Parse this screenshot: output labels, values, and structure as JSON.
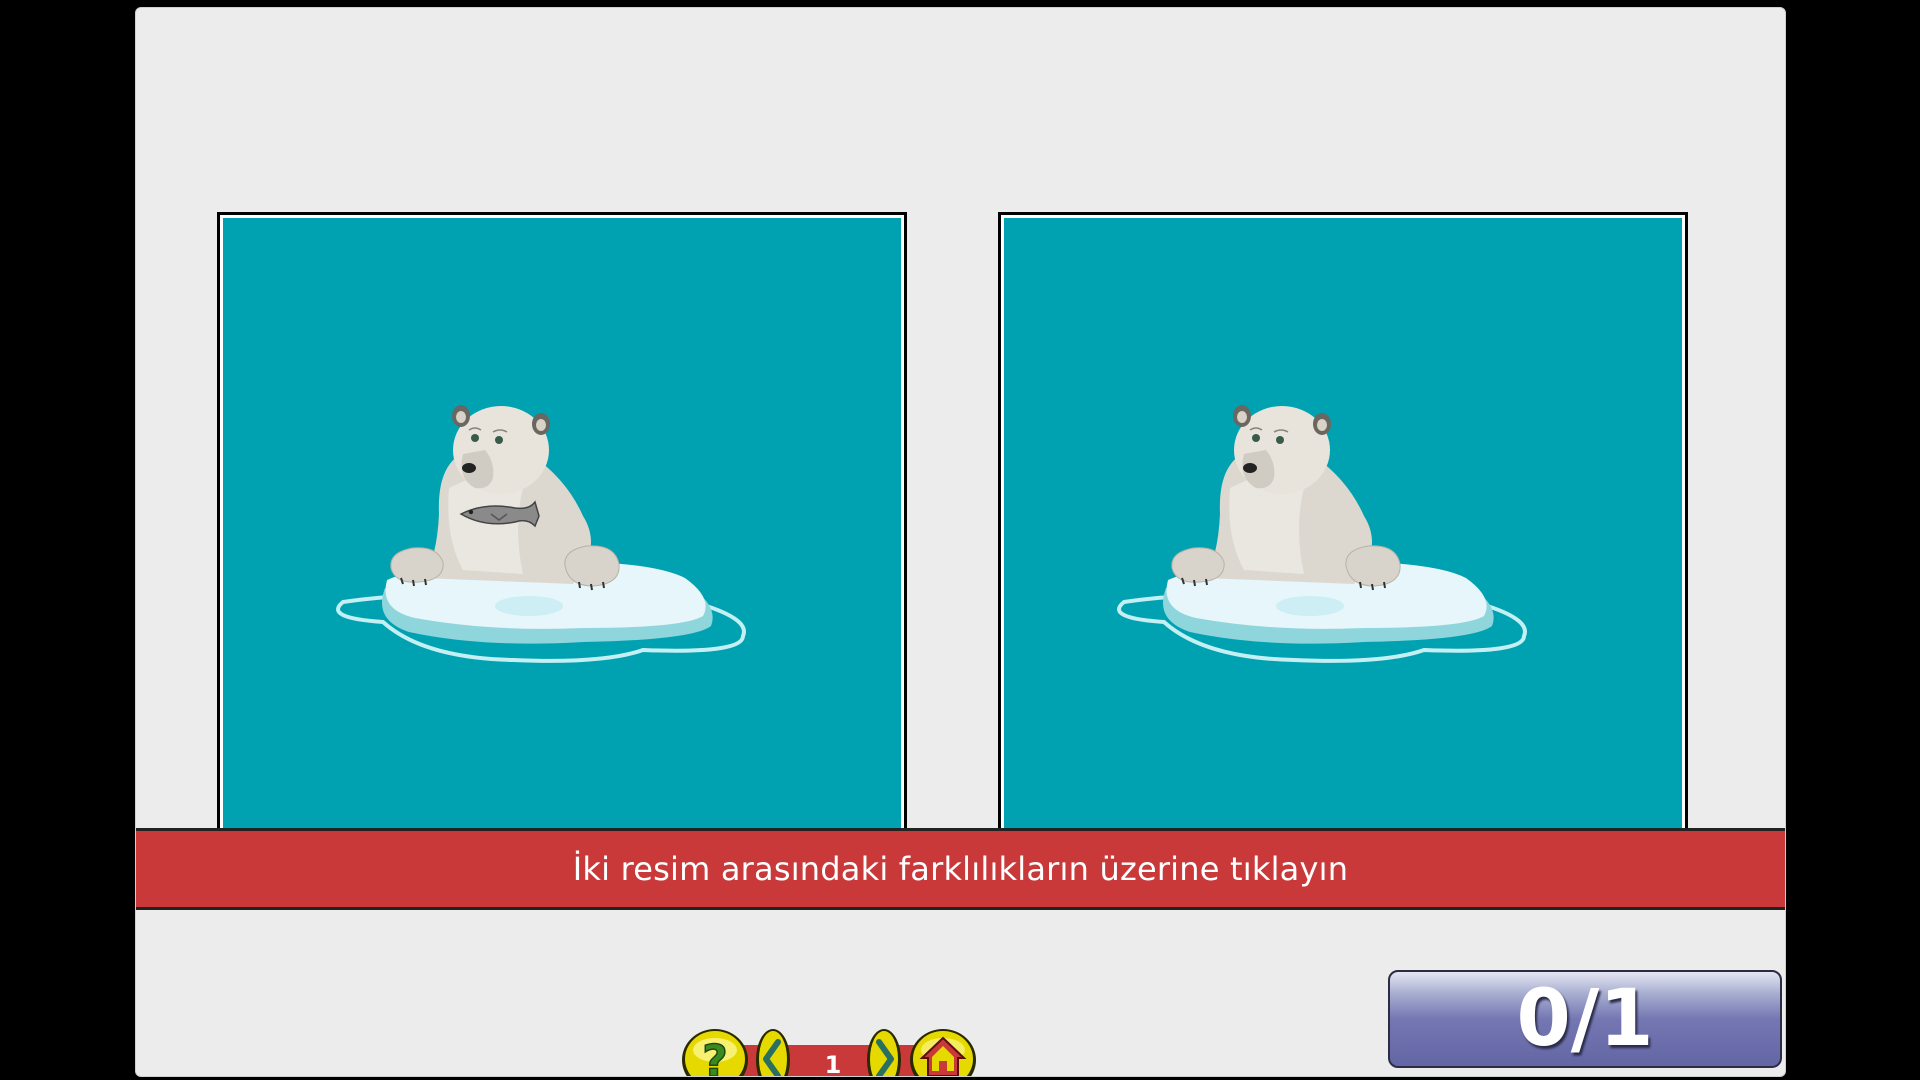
{
  "colors": {
    "sea": "#00a2b1",
    "banner": "#c9393a",
    "stage": "#ececec",
    "score_bar": "#6a6da8"
  },
  "game": {
    "instruction": "İki resim arasındaki farklılıkların üzerine tıklayın",
    "score": "0/1",
    "page_number": "1"
  },
  "panels": [
    {
      "name": "left-picture",
      "bear_holds_fish": true
    },
    {
      "name": "right-picture",
      "bear_holds_fish": false
    }
  ],
  "controls": {
    "icons": [
      "help-icon",
      "previous-arrow-icon",
      "next-arrow-icon",
      "home-icon"
    ]
  }
}
